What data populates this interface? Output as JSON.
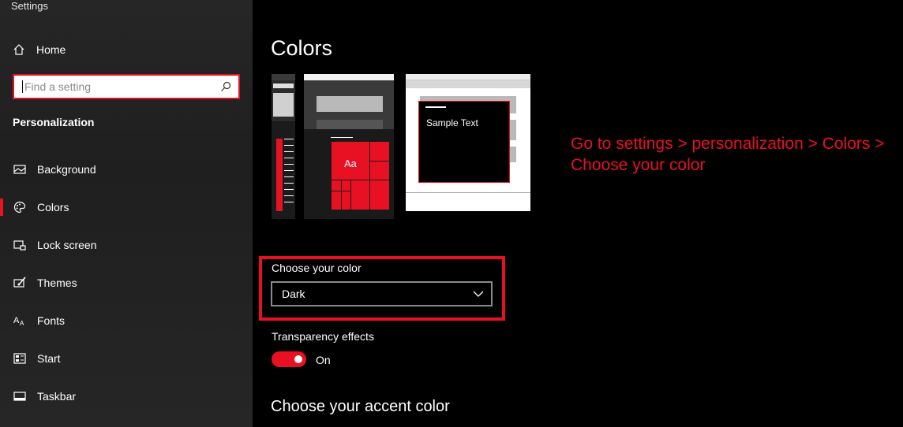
{
  "window": {
    "title": "Settings"
  },
  "sidebar": {
    "home_label": "Home",
    "search_placeholder": "Find a setting",
    "section": "Personalization",
    "items": [
      {
        "label": "Background",
        "icon": "image-icon"
      },
      {
        "label": "Colors",
        "icon": "palette-icon",
        "active": true
      },
      {
        "label": "Lock screen",
        "icon": "lock-screen-icon"
      },
      {
        "label": "Themes",
        "icon": "brush-icon"
      },
      {
        "label": "Fonts",
        "icon": "fonts-icon"
      },
      {
        "label": "Start",
        "icon": "start-icon"
      },
      {
        "label": "Taskbar",
        "icon": "taskbar-icon"
      }
    ]
  },
  "main": {
    "title": "Colors",
    "preview": {
      "aa_label": "Aa",
      "sample_text": "Sample Text"
    },
    "annotation": "Go to settings > personalization > Colors > Choose your color",
    "choose_color_label": "Choose your color",
    "choose_color_value": "Dark",
    "transparency_label": "Transparency effects",
    "transparency_state": "On",
    "accent_title": "Choose your accent color"
  },
  "colors": {
    "accent": "#e81123",
    "background": "#000000",
    "sidebar": "#222222"
  }
}
